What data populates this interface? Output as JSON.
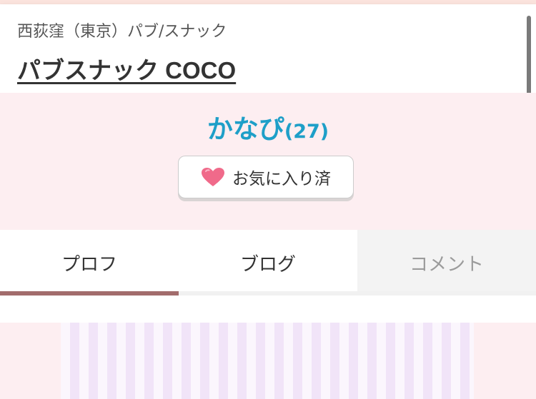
{
  "header": {
    "area_line": "西荻窪（東京）パブ/スナック",
    "shop_name": "パブスナック COCO"
  },
  "profile": {
    "cast_name": "かなぴ",
    "cast_age": "(27)",
    "favorite_label": "お気に入り済"
  },
  "tabs": [
    {
      "label": "プロフ",
      "active": true
    },
    {
      "label": "ブログ",
      "active": false
    },
    {
      "label": "コメント",
      "active": false
    }
  ],
  "colors": {
    "accent": "#1e9fc8",
    "tab_indicator": "#a26c6c",
    "heart": "#f06a8a",
    "pink_bg": "#fdeef1"
  },
  "icons": {
    "favorite": "heart-icon"
  }
}
